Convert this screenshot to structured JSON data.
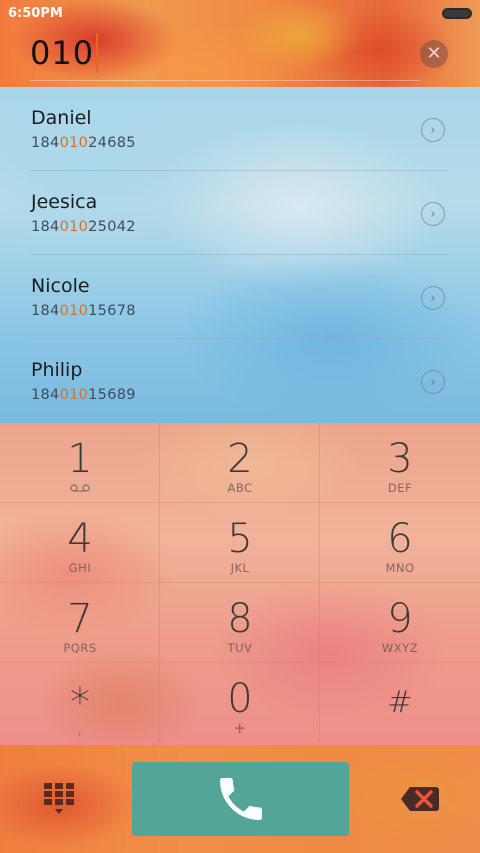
{
  "status_bar": {
    "time": "6:50PM"
  },
  "dialer": {
    "input_value": "010"
  },
  "contacts": [
    {
      "name": "Daniel",
      "number_pre": "184",
      "number_match": "010",
      "number_post": "24685"
    },
    {
      "name": "Jeesica",
      "number_pre": "184",
      "number_match": "010",
      "number_post": "25042"
    },
    {
      "name": "Nicole",
      "number_pre": "184",
      "number_match": "010",
      "number_post": "15678"
    },
    {
      "name": "Philip",
      "number_pre": "184",
      "number_match": "010",
      "number_post": "15689"
    }
  ],
  "keypad": {
    "keys": [
      {
        "digit": "1",
        "letters": ""
      },
      {
        "digit": "2",
        "letters": "ABC"
      },
      {
        "digit": "3",
        "letters": "DEF"
      },
      {
        "digit": "4",
        "letters": "GHI"
      },
      {
        "digit": "5",
        "letters": "JKL"
      },
      {
        "digit": "6",
        "letters": "MNO"
      },
      {
        "digit": "7",
        "letters": "PQRS"
      },
      {
        "digit": "8",
        "letters": "TUV"
      },
      {
        "digit": "9",
        "letters": "WXYZ"
      },
      {
        "digit": "*",
        "letters": ","
      },
      {
        "digit": "0",
        "letters": "+"
      },
      {
        "digit": "#",
        "letters": ""
      }
    ]
  },
  "icons": {
    "clear": "clear-icon",
    "detail": "chevron-right-icon",
    "voicemail": "voicemail-icon",
    "keypad_toggle": "keypad-grid-icon",
    "call": "phone-icon",
    "backspace": "backspace-icon"
  },
  "colors": {
    "match_highlight": "#e06f1e",
    "call_button": "#53a697",
    "caret": "#e26a1d"
  }
}
